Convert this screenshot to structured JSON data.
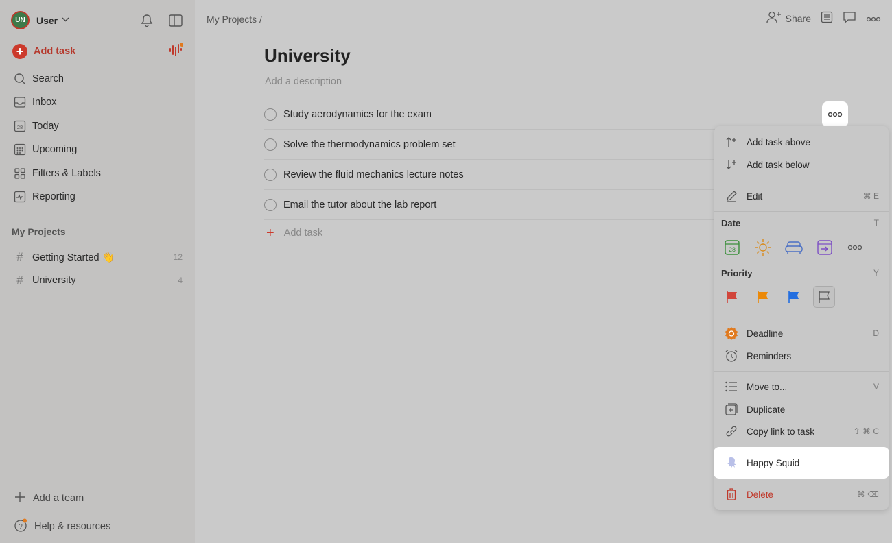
{
  "sidebar": {
    "user": {
      "initials": "UN",
      "name": "User"
    },
    "add_task": "Add task",
    "nav": [
      {
        "label": "Search",
        "icon": "search-icon"
      },
      {
        "label": "Inbox",
        "icon": "inbox-icon"
      },
      {
        "label": "Today",
        "icon": "calendar-today-icon",
        "day": "28"
      },
      {
        "label": "Upcoming",
        "icon": "calendar-upcoming-icon"
      },
      {
        "label": "Filters & Labels",
        "icon": "filters-icon"
      },
      {
        "label": "Reporting",
        "icon": "reporting-icon"
      }
    ],
    "projects_title": "My Projects",
    "projects": [
      {
        "name": "Getting Started 👋",
        "count": "12"
      },
      {
        "name": "University",
        "count": "4"
      }
    ],
    "add_team": "Add a team",
    "help": "Help & resources"
  },
  "header": {
    "breadcrumb": "My Projects /",
    "share": "Share"
  },
  "project": {
    "title": "University",
    "description_placeholder": "Add a description",
    "tasks": [
      "Study aerodynamics for the exam",
      "Solve the thermodynamics problem set",
      "Review the fluid mechanics lecture notes",
      "Email the tutor about the lab report"
    ],
    "add_task": "Add task"
  },
  "menu": {
    "add_above": "Add task above",
    "add_below": "Add task below",
    "edit": "Edit",
    "edit_key": "⌘ E",
    "date_label": "Date",
    "date_key": "T",
    "date_today_num": "28",
    "priority_label": "Priority",
    "priority_key": "Y",
    "deadline": "Deadline",
    "deadline_key": "D",
    "reminders": "Reminders",
    "move_to": "Move to...",
    "move_key": "V",
    "duplicate": "Duplicate",
    "copy_link": "Copy link to task",
    "copy_key": "⇧ ⌘ C",
    "happy_squid": "Happy Squid",
    "delete": "Delete",
    "delete_key": "⌘ ⌫"
  },
  "colors": {
    "accent": "#cc3a2c",
    "priority1": "#d1453b",
    "priority2": "#eb8909",
    "priority3": "#246fe0"
  }
}
